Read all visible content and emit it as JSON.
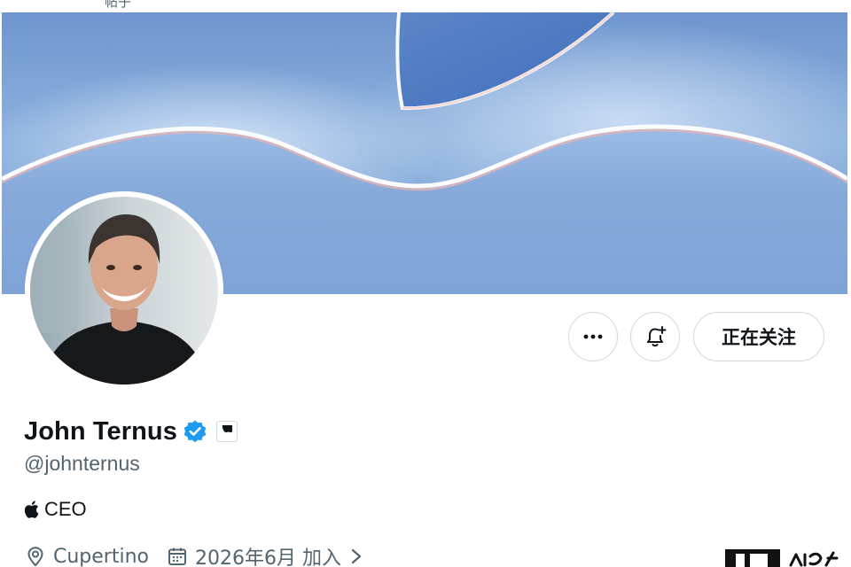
{
  "top": {
    "partial_text": "帖子"
  },
  "profile": {
    "display_name": "John Ternus",
    "handle": "@johnternus",
    "bio": "CEO",
    "location": "Cupertino",
    "joined": "2026年6月 加入",
    "verified": true
  },
  "actions": {
    "more_icon": "more-horizontal-icon",
    "notify_icon": "bell-plus-icon",
    "follow_label": "正在关注"
  },
  "icons": {
    "verified": "verified-badge-icon",
    "affiliate": "apple-logo-icon",
    "location": "location-pin-icon",
    "calendar": "calendar-icon",
    "chevron": "chevron-right-icon"
  },
  "colors": {
    "verified_blue": "#1d9bf0",
    "text_primary": "#0f1419",
    "text_secondary": "#536471",
    "border": "#cfd9de",
    "banner_blue": "#7ea4d8"
  }
}
